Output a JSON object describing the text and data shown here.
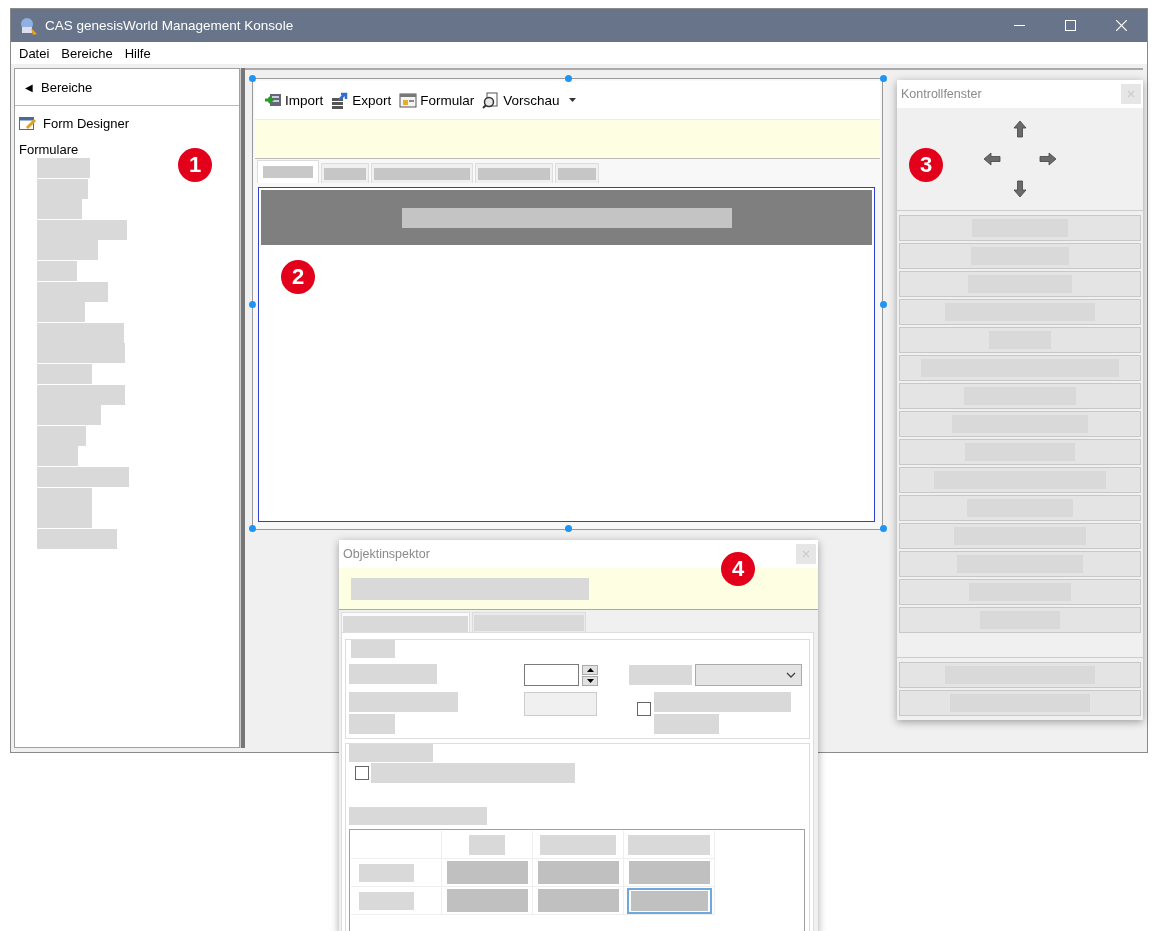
{
  "window": {
    "title": "CAS genesisWorld Management Konsole"
  },
  "menu": [
    "Datei",
    "Bereiche",
    "Hilfe"
  ],
  "sidebar": {
    "back_icon": "◀",
    "back": "Bereiche",
    "section": "Form Designer",
    "group": "Formulare",
    "marker": "1"
  },
  "toolbar": [
    {
      "label": "Import",
      "kind": "button"
    },
    {
      "label": "Export",
      "kind": "button"
    },
    {
      "label": "Formular",
      "kind": "button"
    },
    {
      "label": "Vorschau",
      "kind": "dropdown"
    }
  ],
  "designer": {
    "marker": "2",
    "tabs": [
      {
        "selected": true
      },
      {
        "selected": false
      },
      {
        "selected": false
      },
      {
        "selected": false
      },
      {
        "selected": false
      }
    ]
  },
  "control_window": {
    "title": "Kontrollfenster",
    "marker": "3"
  },
  "inspector": {
    "title": "Objektinspektor",
    "marker": "4",
    "tabs": [
      {
        "selected": true
      },
      {
        "selected": false
      }
    ],
    "checkboxes": [
      {
        "checked": false
      },
      {
        "checked": false
      }
    ],
    "grid_rows": [
      [
        {
          "selected": false
        },
        {
          "selected": false
        },
        {
          "selected": false
        }
      ],
      [
        {
          "selected": false
        },
        {
          "selected": false
        },
        {
          "selected": true
        }
      ]
    ]
  }
}
